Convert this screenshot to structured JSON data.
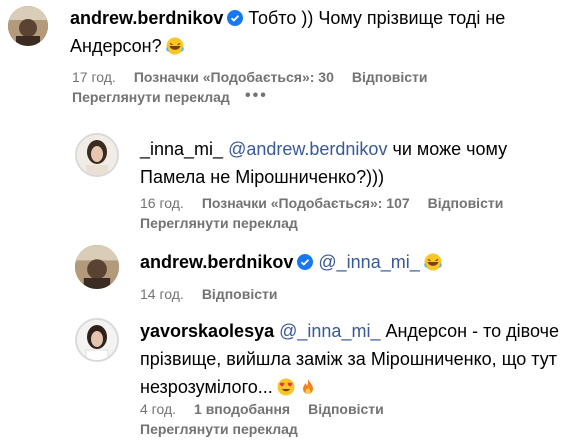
{
  "comments": [
    {
      "username": "andrew.berdnikov",
      "verified": true,
      "text_line1": "Тобто )) Чому прізвище тоді не",
      "text_line2": "Андерсон?",
      "emoji": "laughing-emoji",
      "time": "17 год.",
      "likes": "Позначки «Подобається»: 30",
      "reply": "Відповісти",
      "translate": "Переглянути переклад",
      "more": "•••"
    },
    {
      "username": "_inna_mi_",
      "mention": "@andrew.berdnikov",
      "text_line1": "чи може чому",
      "text_line2": "Памела не Мірошниченко?)))",
      "time": "16 год.",
      "likes": "Позначки «Подобається»: 107",
      "reply": "Відповісти",
      "translate": "Переглянути переклад"
    },
    {
      "username": "andrew.berdnikov",
      "verified": true,
      "mention": "@_inna_mi_",
      "emoji": "laughing-emoji",
      "time": "14 год.",
      "reply": "Відповісти"
    },
    {
      "username": "yavorskaolesya",
      "mention": "@_inna_mi_",
      "text_line1": "Андерсон - то дівоче",
      "text_line2": "прізвище, вийшла заміж за Мірошниченко, що тут",
      "text_line3": "незрозумілого...",
      "emojis": [
        "heart-eyes-emoji",
        "fire-emoji"
      ],
      "time": "4 год.",
      "likes": "1 вподобання",
      "reply": "Відповісти",
      "translate": "Переглянути переклад"
    }
  ]
}
